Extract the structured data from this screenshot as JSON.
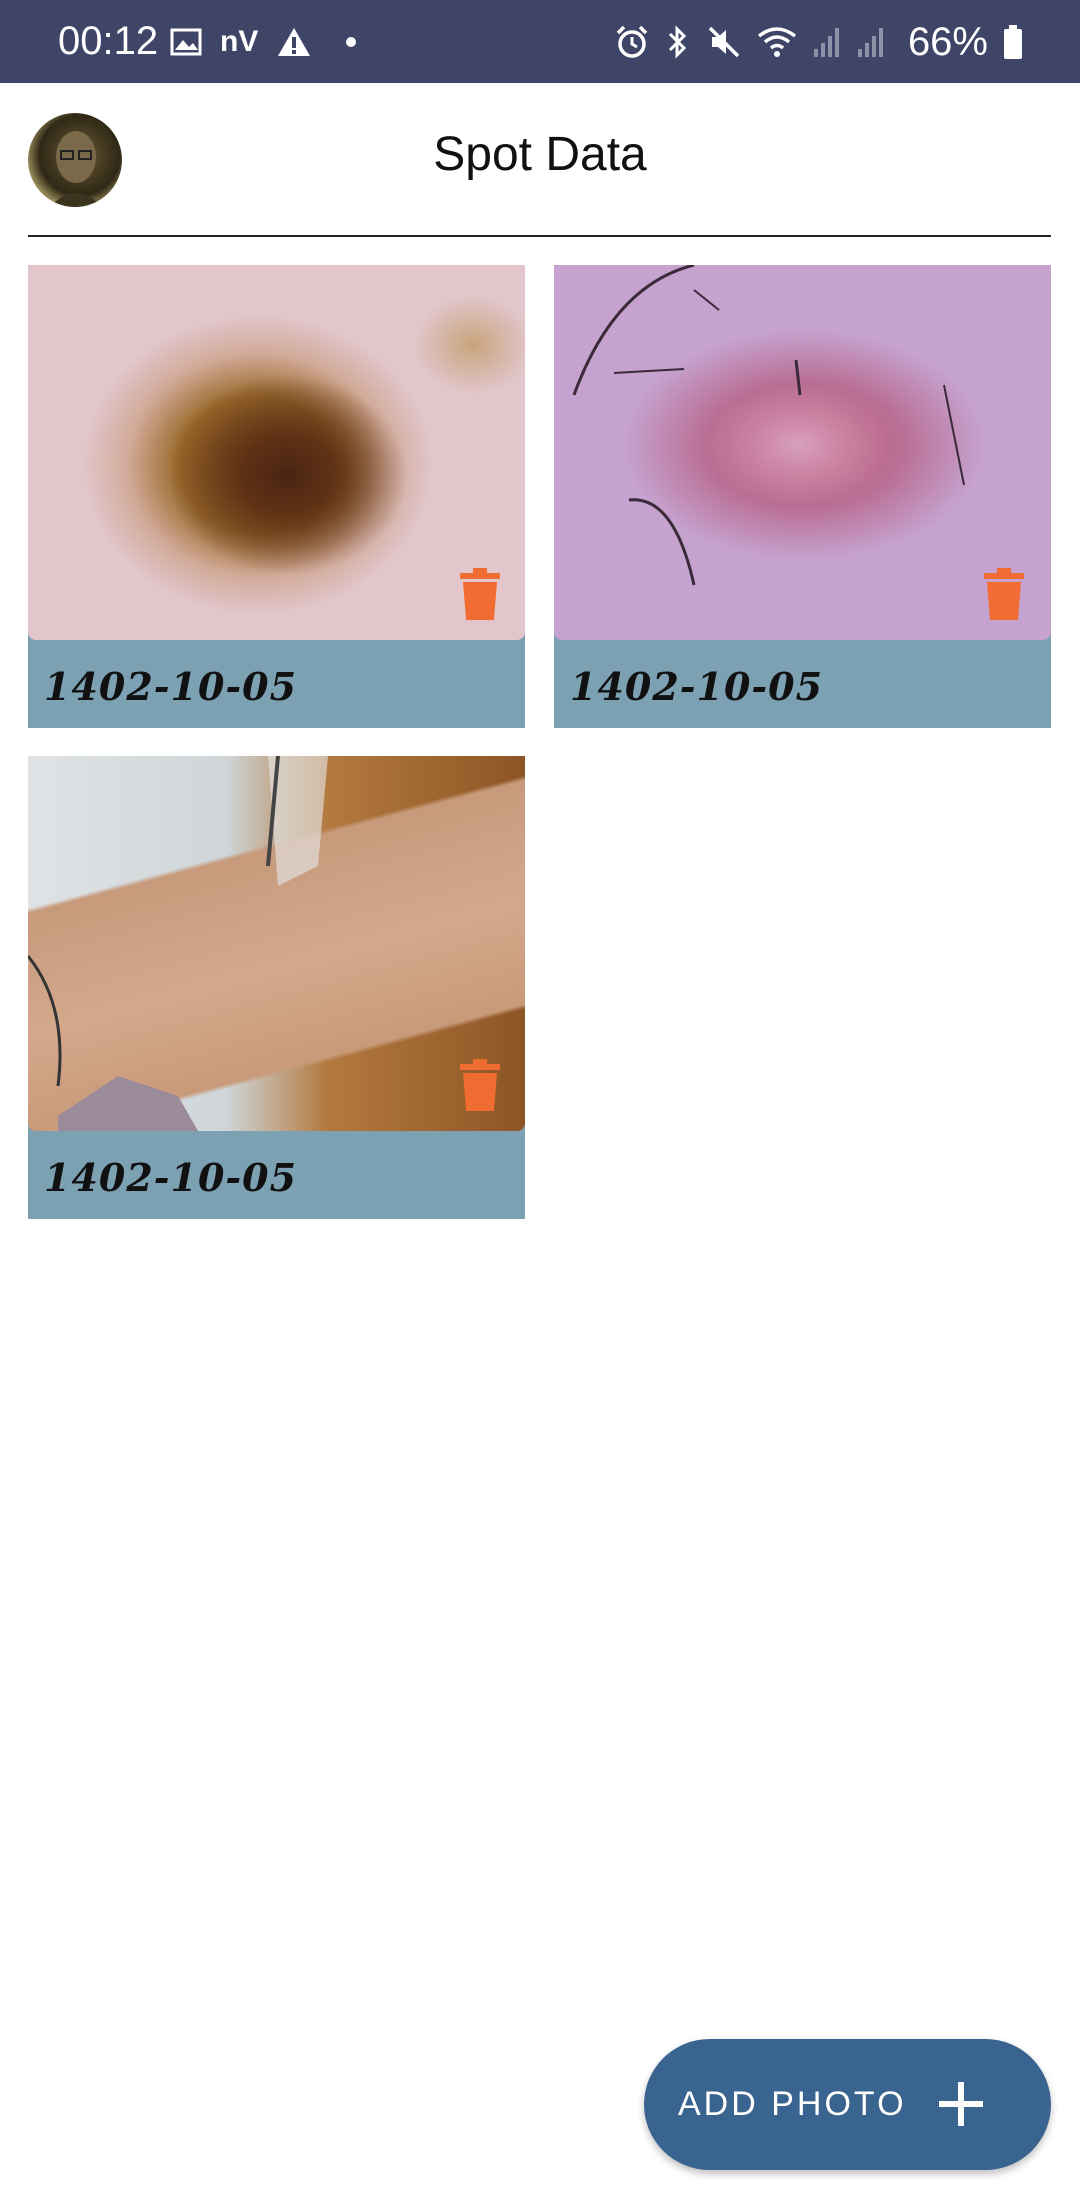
{
  "status_bar": {
    "time": "00:12",
    "carrier": "nV",
    "battery": "66%",
    "left_icons": [
      "image-icon",
      "warning-icon",
      "dot-icon"
    ],
    "right_icons": [
      "alarm-icon",
      "bluetooth-icon",
      "mute-icon",
      "wifi-icon",
      "signal-icon",
      "signal-icon",
      "battery-icon"
    ]
  },
  "header": {
    "title": "Spot Data"
  },
  "photos": [
    {
      "date": "1402-10-05",
      "image": "skin-lesion-photo"
    },
    {
      "date": "1402-10-05",
      "image": "skin-lesion-photo"
    },
    {
      "date": "1402-10-05",
      "image": "arm-photo"
    }
  ],
  "fab": {
    "label": "ADD PHOTO",
    "icon": "plus-icon"
  },
  "colors": {
    "status_bar": "#3e4566",
    "card_footer": "#7ba1b3",
    "trash": "#f06c32",
    "fab": "#3a6490"
  }
}
